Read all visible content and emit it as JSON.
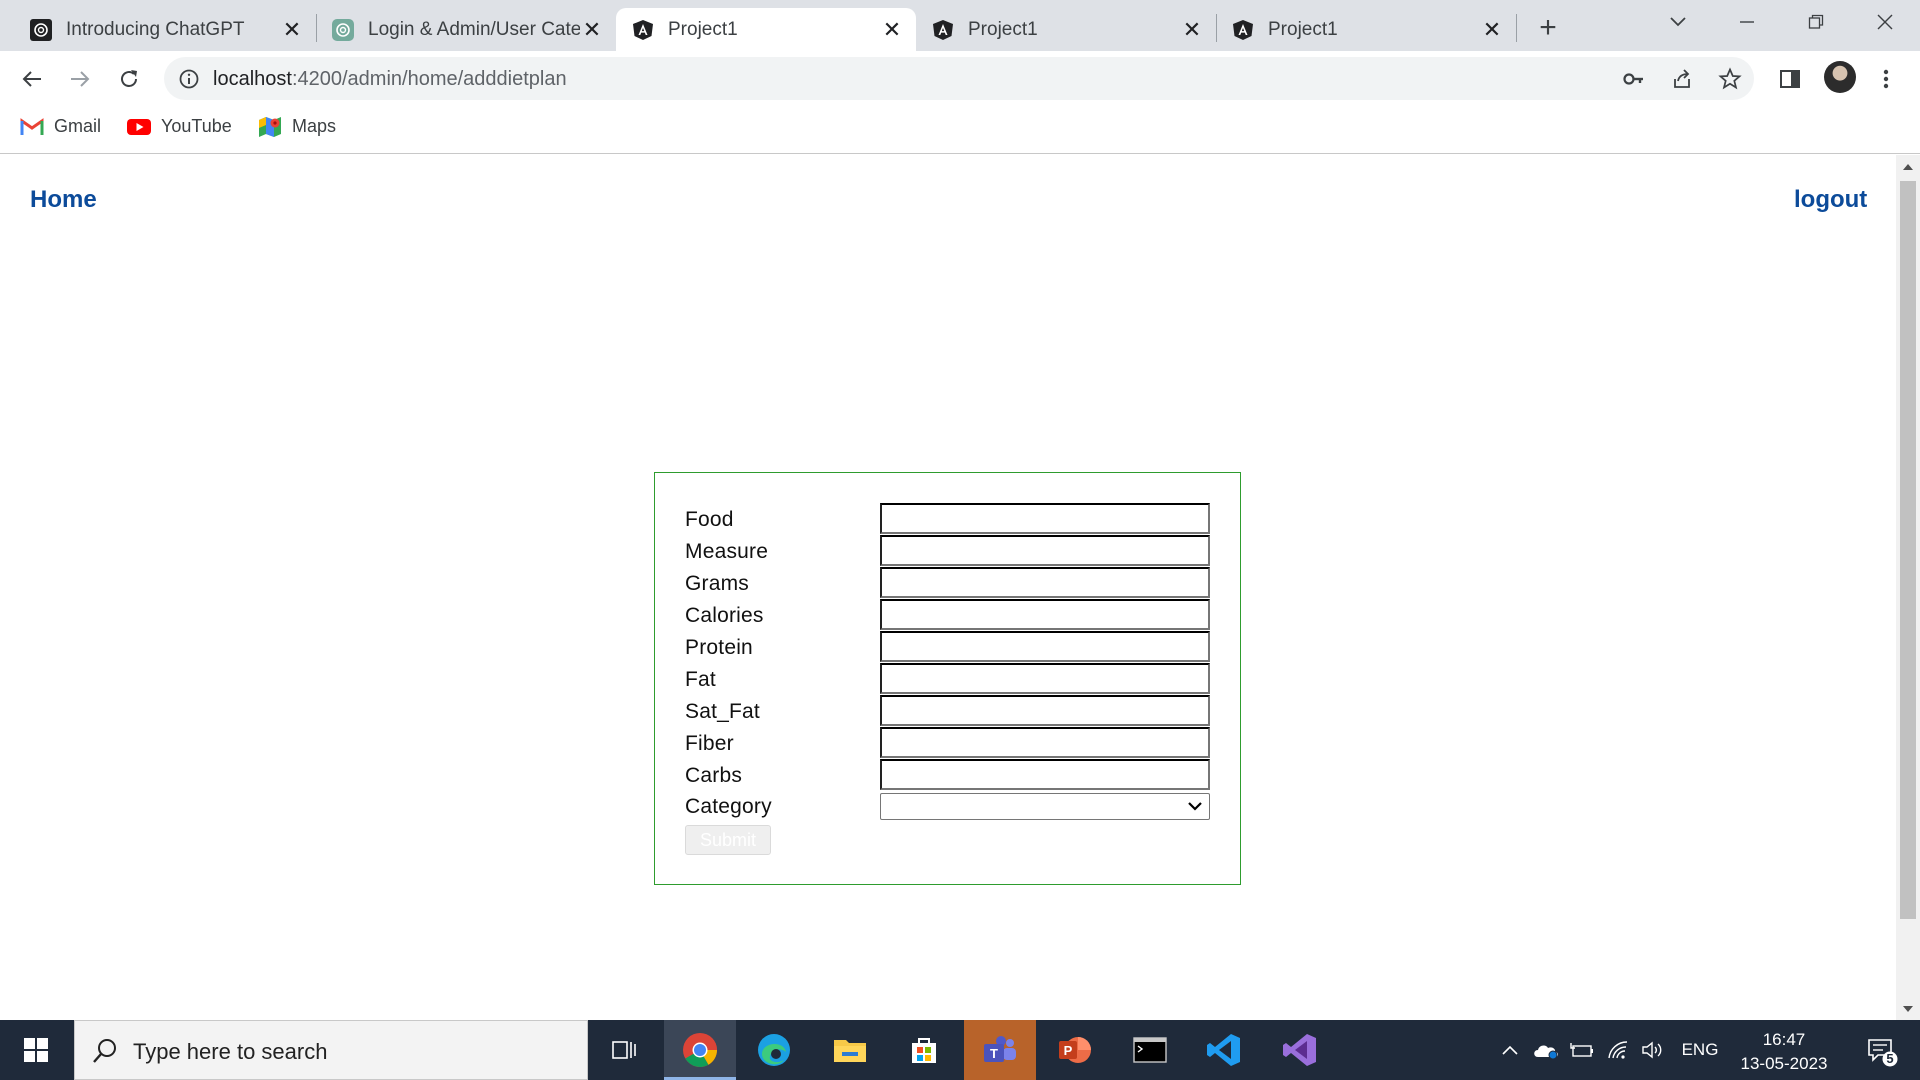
{
  "browser": {
    "tabs": [
      {
        "title": "Introducing ChatGPT",
        "icon": "openai-icon",
        "active": false
      },
      {
        "title": "Login & Admin/User Cate",
        "icon": "openai-icon",
        "active": false
      },
      {
        "title": "Project1",
        "icon": "angular-icon",
        "active": true
      },
      {
        "title": "Project1",
        "icon": "angular-icon",
        "active": false
      },
      {
        "title": "Project1",
        "icon": "angular-icon",
        "active": false
      }
    ],
    "url_host": "localhost",
    "url_path": ":4200/admin/home/adddietplan",
    "bookmarks": [
      {
        "label": "Gmail",
        "icon": "gmail-icon"
      },
      {
        "label": "YouTube",
        "icon": "youtube-icon"
      },
      {
        "label": "Maps",
        "icon": "maps-icon"
      }
    ]
  },
  "page": {
    "nav_home": "Home",
    "nav_logout": "logout",
    "form": {
      "fields": [
        {
          "label": "Food",
          "value": ""
        },
        {
          "label": "Measure",
          "value": ""
        },
        {
          "label": "Grams",
          "value": ""
        },
        {
          "label": "Calories",
          "value": ""
        },
        {
          "label": "Protein",
          "value": ""
        },
        {
          "label": "Fat",
          "value": ""
        },
        {
          "label": "Sat_Fat",
          "value": ""
        },
        {
          "label": "Fiber",
          "value": ""
        },
        {
          "label": "Carbs",
          "value": ""
        }
      ],
      "category_label": "Category",
      "category_value": "",
      "submit_label": "Submit",
      "border_color": "#2e9c2e"
    },
    "link_color": "#0c4b9a"
  },
  "taskbar": {
    "search_placeholder": "Type here to search",
    "language": "ENG",
    "time": "16:47",
    "date": "13-05-2023",
    "notification_count": "5"
  }
}
